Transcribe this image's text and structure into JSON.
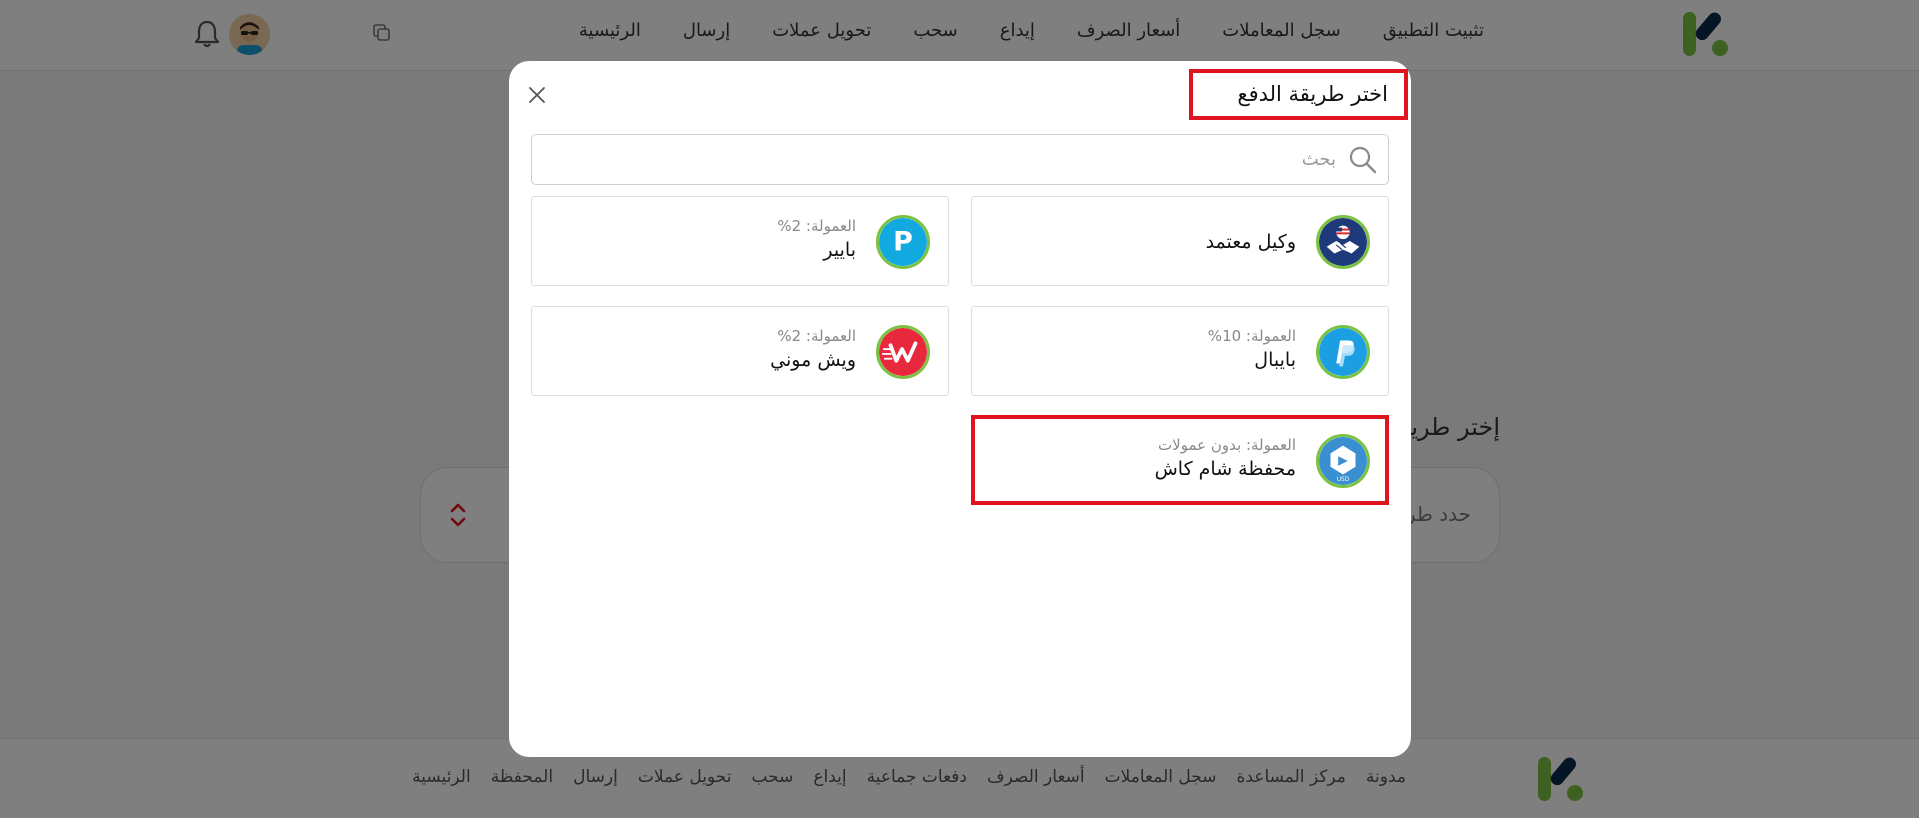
{
  "header": {
    "nav": [
      "الرئيسية",
      "إرسال",
      "تحويل عملات",
      "سحب",
      "إيداع",
      "أسعار الصرف",
      "سجل المعاملات",
      "تثبيت التطبيق"
    ]
  },
  "page": {
    "section_title": "إختر طريقة",
    "select_placeholder": "حدد طريقة"
  },
  "footer": {
    "nav": [
      "الرئيسية",
      "المحفظة",
      "إرسال",
      "تحويل عملات",
      "سحب",
      "إيداع",
      "دفعات جماعية",
      "أسعار الصرف",
      "سجل المعاملات",
      "مركز المساعدة",
      "مدونة"
    ]
  },
  "modal": {
    "title": "اختر طريقة الدفع",
    "search_placeholder": "بحث",
    "methods": [
      {
        "name": "وكيل معتمد",
        "fee": "",
        "icon": "handshake-flag-icon"
      },
      {
        "name": "بايير",
        "fee": "العمولة: 2%",
        "icon": "payeer-p-icon"
      },
      {
        "name": "بايبال",
        "fee": "العمولة: 10%",
        "icon": "paypal-icon"
      },
      {
        "name": "ويش موني",
        "fee": "العمولة: 2%",
        "icon": "wishmoney-w-icon"
      },
      {
        "name": "محفظة شام كاش",
        "fee": "العمولة: بدون عمولات",
        "icon": "shamcash-usd-icon"
      }
    ]
  },
  "colors": {
    "accent_green": "#7cc242",
    "highlight_red": "#e0141e",
    "logo_dark": "#0d2a4a"
  }
}
